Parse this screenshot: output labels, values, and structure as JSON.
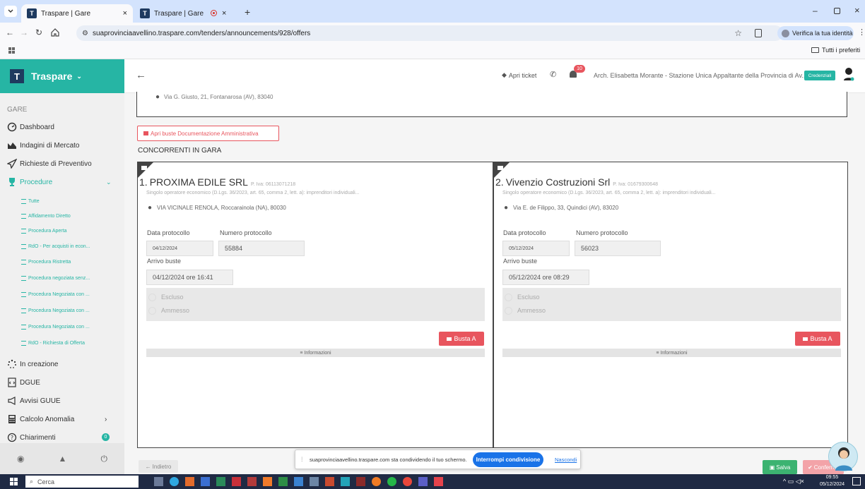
{
  "browser": {
    "tabs": [
      {
        "title": "Traspare | Gare"
      },
      {
        "title": "Traspare | Gare"
      }
    ],
    "url": "suaprovinciaavellino.traspare.com/tenders/announcements/928/offers",
    "verify_identity": "Verifica la tua identità",
    "bookmarks_label": "Tutti i preferiti",
    "favicon_letter": "T"
  },
  "sidebar": {
    "brand": "Traspare",
    "section": "GARE",
    "items": [
      {
        "label": "Dashboard",
        "icon": "dashboard-icon"
      },
      {
        "label": "Indagini di Mercato",
        "icon": "chart-area-icon"
      },
      {
        "label": "Richieste di Preventivo",
        "icon": "paper-plane-icon"
      },
      {
        "label": "Procedure",
        "icon": "trophy-icon"
      }
    ],
    "procedure_sub": [
      "Tutte",
      "Affidamento Diretto",
      "Procedura Aperta",
      "RdO - Per acquisti in econ...",
      "Procedura Ristretta",
      "Procedura negoziata senz...",
      "Procedura Negoziata con ...",
      "Procedura Negoziata con ...",
      "Procedura Negoziata con ...",
      "RdO - Richiesta di Offerta"
    ],
    "items_bottom": [
      {
        "label": "In creazione",
        "icon": "spinner-icon"
      },
      {
        "label": "DGUE",
        "icon": "file-code-icon"
      },
      {
        "label": "Avvisi GUUE",
        "icon": "bullhorn-icon"
      },
      {
        "label": "Calcolo Anomalia",
        "icon": "calculator-icon"
      },
      {
        "label": "Chiarimenti",
        "icon": "question-circle-icon",
        "badge": "0"
      }
    ]
  },
  "header": {
    "ticket": "Apri ticket",
    "notifications": "10",
    "user": "Arch. Elisabetta Morante - Stazione Unica Appaltante della Provincia di Av...",
    "credentials": "Credenziali"
  },
  "main": {
    "top_address": "Via G. Giusto, 21, Fontanarosa (AV), 83040",
    "open_admin_button": "Apri buste Documentazione Amministrativa",
    "section_title": "CONCORRENTI IN GARA",
    "labels": {
      "date": "Data protocollo",
      "number": "Numero protocollo",
      "arrival": "Arrivo buste",
      "excluded": "Escluso",
      "admitted": "Ammesso",
      "busta": "Busta A",
      "info": "Informazioni"
    },
    "competitors": [
      {
        "index": "1.",
        "name": "PROXIMA EDILE SRL",
        "piva": "P. Iva: 06113071218",
        "type": "Singolo operatore economico (D.Lgs. 36/2023, art. 65, comma 2, lett. a): imprenditori individuali...",
        "address": "VIA VICINALE RENOLA, Roccarainola (NA), 80030",
        "date": "04/12/2024",
        "protocol": "55884",
        "arrival": "04/12/2024 ore 16:41"
      },
      {
        "index": "2.",
        "name": "Vivenzio Costruzioni Srl",
        "piva": "P. Iva: 01679300648",
        "type": "Singolo operatore economico (D.Lgs. 36/2023, art. 65, comma 2, lett. a): imprenditori individuali...",
        "address": "Via E. de Filippo, 33, Quindici (AV), 83020",
        "date": "05/12/2024",
        "protocol": "56023",
        "arrival": "05/12/2024 ore 08:29"
      }
    ],
    "back_button": "Indietro",
    "save_button": "Salva",
    "confirm_button": "Conferma"
  },
  "share_bar": {
    "text": "suaprovinciaavellino.traspare.com sta condividendo il tuo schermo.",
    "stop": "Interrompi condivisione",
    "hide": "Nascondi"
  },
  "taskbar": {
    "search": "Cerca",
    "time": "09:55",
    "date": "05/12/2024"
  },
  "colors": {
    "accent": "#26b5a4",
    "danger": "#e8555e",
    "brand_dark": "#1e3a5f",
    "share_button": "#1a73e8"
  }
}
